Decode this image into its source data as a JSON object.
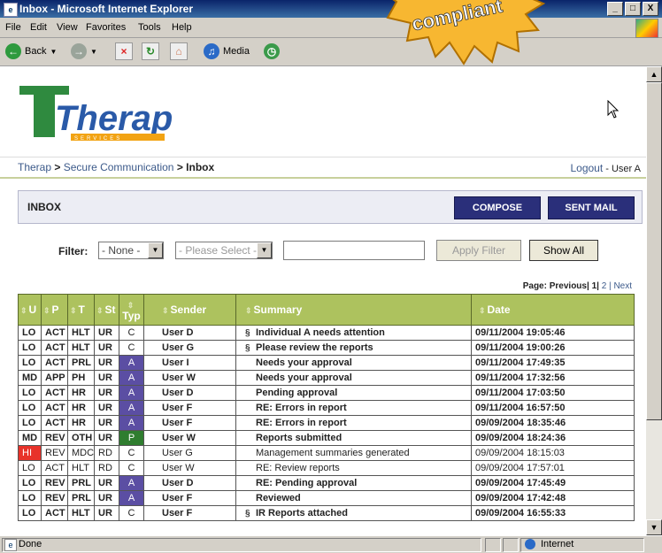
{
  "window": {
    "title": "Inbox - Microsoft Internet Explorer",
    "controls": [
      "_",
      "□",
      "X"
    ]
  },
  "menu": [
    "File",
    "Edit",
    "View",
    "Favorites",
    "Tools",
    "Help"
  ],
  "toolbar": {
    "back": "Back",
    "media": "Media"
  },
  "banner": {
    "text": "compliant"
  },
  "logo": {
    "main": "Therap",
    "sub": "SERVICES"
  },
  "breadcrumb": {
    "home": "Therap",
    "sep": ">",
    "mid": "Secure Communication",
    "current": "Inbox"
  },
  "account": {
    "logout": "Logout",
    "separator": "-",
    "user": "User A"
  },
  "inbox": {
    "label": "INBOX",
    "compose": "COMPOSE",
    "sent": "SENT MAIL"
  },
  "filter": {
    "label": "Filter:",
    "select1": "- None -",
    "select2": "- Please Select -",
    "apply": "Apply Filter",
    "show_all": "Show All"
  },
  "pager": {
    "label": "Page:",
    "previous": "Previous|",
    "current": "1|",
    "page2": "2",
    "sep": "|",
    "next": "Next"
  },
  "table": {
    "headers": {
      "u": "U",
      "p": "P",
      "t": "T",
      "st": "St",
      "typ": "Typ",
      "sender": "Sender",
      "summary": "Summary",
      "date": "Date"
    },
    "rows": [
      {
        "u": "LO",
        "p": "ACT",
        "t": "HLT",
        "st": "UR",
        "typ": "C",
        "sender": "User D",
        "summary": "Individual A needs attention",
        "date": "09/11/2004 19:05:46",
        "attach": true,
        "bold": true
      },
      {
        "u": "LO",
        "p": "ACT",
        "t": "HLT",
        "st": "UR",
        "typ": "C",
        "sender": "User G",
        "summary": "Please review the reports",
        "date": "09/11/2004 19:00:26",
        "attach": true,
        "bold": true
      },
      {
        "u": "LO",
        "p": "ACT",
        "t": "PRL",
        "st": "UR",
        "typ": "A",
        "sender": "User I",
        "summary": "Needs your approval",
        "date": "09/11/2004 17:49:35",
        "attach": false,
        "bold": true
      },
      {
        "u": "MD",
        "p": "APP",
        "t": "PH",
        "st": "UR",
        "typ": "A",
        "sender": "User W",
        "summary": "Needs your approval",
        "date": "09/11/2004 17:32:56",
        "attach": false,
        "bold": true
      },
      {
        "u": "LO",
        "p": "ACT",
        "t": "HR",
        "st": "UR",
        "typ": "A",
        "sender": "User D",
        "summary": "Pending approval",
        "date": "09/11/2004 17:03:50",
        "attach": false,
        "bold": true
      },
      {
        "u": "LO",
        "p": "ACT",
        "t": "HR",
        "st": "UR",
        "typ": "A",
        "sender": "User F",
        "summary": "RE: Errors in report",
        "date": "09/11/2004 16:57:50",
        "attach": false,
        "bold": true
      },
      {
        "u": "LO",
        "p": "ACT",
        "t": "HR",
        "st": "UR",
        "typ": "A",
        "sender": "User F",
        "summary": "RE: Errors in report",
        "date": "09/09/2004 18:35:46",
        "attach": false,
        "bold": true
      },
      {
        "u": "MD",
        "p": "REV",
        "t": "OTH",
        "st": "UR",
        "typ": "P",
        "sender": "User W",
        "summary": "Reports submitted",
        "date": "09/09/2004 18:24:36",
        "attach": false,
        "bold": true
      },
      {
        "u": "HI",
        "p": "REV",
        "t": "MDC",
        "st": "RD",
        "typ": "C",
        "sender": "User G",
        "summary": "Management summaries generated",
        "date": "09/09/2004 18:15:03",
        "attach": false,
        "bold": false
      },
      {
        "u": "LO",
        "p": "ACT",
        "t": "HLT",
        "st": "RD",
        "typ": "C",
        "sender": "User W",
        "summary": "RE: Review reports",
        "date": "09/09/2004 17:57:01",
        "attach": false,
        "bold": false
      },
      {
        "u": "LO",
        "p": "REV",
        "t": "PRL",
        "st": "UR",
        "typ": "A",
        "sender": "User D",
        "summary": "RE: Pending approval",
        "date": "09/09/2004 17:45:49",
        "attach": false,
        "bold": true
      },
      {
        "u": "LO",
        "p": "REV",
        "t": "PRL",
        "st": "UR",
        "typ": "A",
        "sender": "User F",
        "summary": "Reviewed",
        "date": "09/09/2004 17:42:48",
        "attach": false,
        "bold": true
      },
      {
        "u": "LO",
        "p": "ACT",
        "t": "HLT",
        "st": "UR",
        "typ": "C",
        "sender": "User F",
        "summary": "IR Reports attached",
        "date": "09/09/2004 16:55:33",
        "attach": true,
        "bold": true
      }
    ]
  },
  "status": {
    "left": "Done",
    "zone": "Internet"
  },
  "colors": {
    "type_A": "#5b4ea3",
    "type_P": "#2f7d2f",
    "priority_HI": "#e8322a",
    "header": "#adc25e",
    "button": "#2a2f7a"
  },
  "icons": [
    "back-icon",
    "forward-icon",
    "stop-icon",
    "refresh-icon",
    "home-icon",
    "media-icon",
    "history-icon",
    "paperclip-icon",
    "cursor-icon",
    "ie-icon",
    "globe-icon"
  ]
}
